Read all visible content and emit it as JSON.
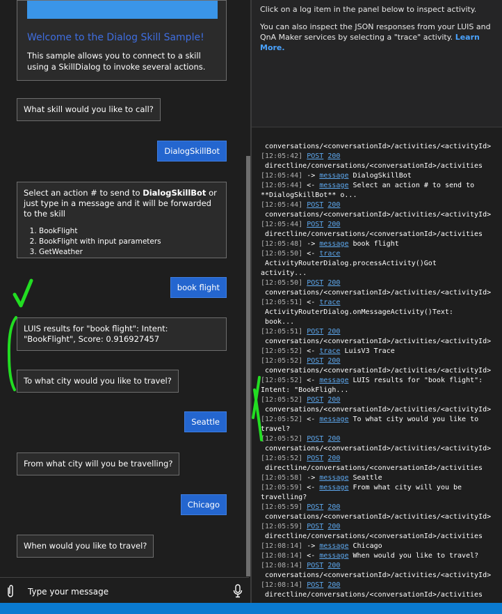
{
  "welcome": {
    "title": "Welcome to the Dialog Skill Sample!",
    "body": "This sample allows you to connect to a skill using a SkillDialog to invoke several actions."
  },
  "chat": {
    "bot_skill_question": "What skill would you like to call?",
    "user_skill_choice": "DialogSkillBot",
    "action_prompt_prefix": "Select an action # to send to ",
    "action_prompt_bold": "DialogSkillBot",
    "action_prompt_suffix": " or just type in a message and it will be forwarded to the skill",
    "actions": [
      "BookFlight",
      "BookFlight with input parameters",
      "GetWeather"
    ],
    "user_book_flight": "book flight",
    "luis_result": "LUIS results for \"book flight\": Intent: \"BookFlight\", Score: 0.916927457",
    "bot_travel_to": "To what city would you like to travel?",
    "user_seattle": "Seattle",
    "bot_travel_from": "From what city will you be travelling?",
    "user_chicago": "Chicago",
    "bot_when": "When would you like to travel?"
  },
  "composer": {
    "placeholder": "Type your message"
  },
  "inspector": {
    "intro1": "Click on a log item in the panel below to inspect activity.",
    "intro2": "You can also inspect the JSON responses from your LUIS and QnA Maker services by selecting a \"trace\" activity.",
    "learn_more": "Learn More."
  },
  "log": [
    {
      "cont": "conversations/<conversationId>/activities/<activityId>"
    },
    {
      "ts": "[12:05:42]",
      "dir": "",
      "link": "POST",
      "status": "200"
    },
    {
      "cont": "directline/conversations/<conversationId>/activities"
    },
    {
      "ts": "[12:05:44]",
      "dir": "->",
      "link": "message",
      "text": "DialogSkillBot"
    },
    {
      "ts": "[12:05:44]",
      "dir": "<-",
      "link": "message",
      "text": "Select an action # to send to **DialogSkillBot** o..."
    },
    {
      "ts": "[12:05:44]",
      "dir": "",
      "link": "POST",
      "status": "200"
    },
    {
      "cont": "conversations/<conversationId>/activities/<activityId>"
    },
    {
      "ts": "[12:05:44]",
      "dir": "",
      "link": "POST",
      "status": "200"
    },
    {
      "cont": "directline/conversations/<conversationId>/activities"
    },
    {
      "ts": "[12:05:48]",
      "dir": "->",
      "link": "message",
      "text": "book flight"
    },
    {
      "ts": "[12:05:50]",
      "dir": "<-",
      "link": "trace"
    },
    {
      "cont": "ActivityRouterDialog.processActivity()Got"
    },
    {
      "plain": "activity..."
    },
    {
      "ts": "[12:05:50]",
      "dir": "",
      "link": "POST",
      "status": "200"
    },
    {
      "cont": "conversations/<conversationId>/activities/<activityId>"
    },
    {
      "ts": "[12:05:51]",
      "dir": "<-",
      "link": "trace"
    },
    {
      "cont": "ActivityRouterDialog.onMessageActivity()Text:"
    },
    {
      "cont": "book..."
    },
    {
      "ts": "[12:05:51]",
      "dir": "",
      "link": "POST",
      "status": "200"
    },
    {
      "cont": "conversations/<conversationId>/activities/<activityId>"
    },
    {
      "ts": "[12:05:52]",
      "dir": "<-",
      "link": "trace",
      "text": "LuisV3 Trace"
    },
    {
      "ts": "[12:05:52]",
      "dir": "",
      "link": "POST",
      "status": "200"
    },
    {
      "cont": "conversations/<conversationId>/activities/<activityId>"
    },
    {
      "ts": "[12:05:52]",
      "dir": "<-",
      "link": "message",
      "text": "LUIS results for \"book flight\": Intent: \"BookFligh..."
    },
    {
      "ts": "[12:05:52]",
      "dir": "",
      "link": "POST",
      "status": "200"
    },
    {
      "cont": "conversations/<conversationId>/activities/<activityId>"
    },
    {
      "ts": "[12:05:52]",
      "dir": "<-",
      "link": "message",
      "text": "To what city would you like to travel?"
    },
    {
      "ts": "[12:05:52]",
      "dir": "",
      "link": "POST",
      "status": "200"
    },
    {
      "cont": "conversations/<conversationId>/activities/<activityId>"
    },
    {
      "ts": "[12:05:52]",
      "dir": "",
      "link": "POST",
      "status": "200"
    },
    {
      "cont": "directline/conversations/<conversationId>/activities"
    },
    {
      "ts": "[12:05:58]",
      "dir": "->",
      "link": "message",
      "text": "Seattle"
    },
    {
      "ts": "[12:05:59]",
      "dir": "<-",
      "link": "message",
      "text": "From what city will you be travelling?"
    },
    {
      "ts": "[12:05:59]",
      "dir": "",
      "link": "POST",
      "status": "200"
    },
    {
      "cont": "conversations/<conversationId>/activities/<activityId>"
    },
    {
      "ts": "[12:05:59]",
      "dir": "",
      "link": "POST",
      "status": "200"
    },
    {
      "cont": "directline/conversations/<conversationId>/activities"
    },
    {
      "ts": "[12:08:14]",
      "dir": "->",
      "link": "message",
      "text": "Chicago"
    },
    {
      "ts": "[12:08:14]",
      "dir": "<-",
      "link": "message",
      "text": "When would you like to travel?"
    },
    {
      "ts": "[12:08:14]",
      "dir": "",
      "link": "POST",
      "status": "200"
    },
    {
      "cont": "conversations/<conversationId>/activities/<activityId>"
    },
    {
      "ts": "[12:08:14]",
      "dir": "",
      "link": "POST",
      "status": "200"
    },
    {
      "cont": "directline/conversations/<conversationId>/activities"
    }
  ],
  "colors": {
    "background": "#1e1e1e",
    "user_bubble": "#2466cf",
    "link": "#5ea9f0",
    "status_bar": "#0a7ad0",
    "annotation": "#22dd22"
  },
  "icons": {
    "attach": "paperclip-icon",
    "mic": "microphone-icon"
  }
}
